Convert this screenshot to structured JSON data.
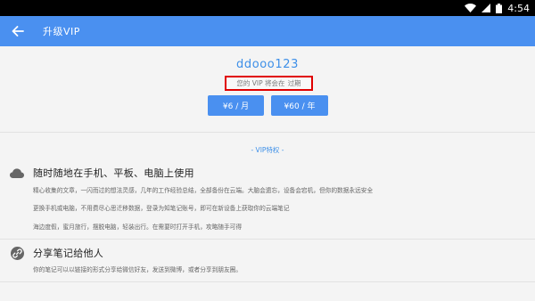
{
  "statusbar": {
    "time": "4:54"
  },
  "appbar": {
    "title": "升级VIP"
  },
  "account": {
    "username": "ddooo123",
    "expire_prefix": "您的 VIP 将会在",
    "expire_suffix": "过期"
  },
  "plans": {
    "month_label": "¥6 / 月",
    "year_label": "¥60 / 年"
  },
  "vip_section": {
    "title": "- VIP特权 -"
  },
  "features": [
    {
      "icon": "cloud-icon",
      "title": "随时随地在手机、平板、电脑上使用",
      "lines": [
        "精心收集的文章，一闪而过的想法灵感，几年的工作经验总结，全部备份在云端。大脑会遗忘，设备会宕机，但你的数据永远安全",
        "更换手机或电脑，不用费尽心思迁移数据，登录为知笔记账号，即可在新设备上获取你的云端笔记",
        "海边度假，蜜月旅行，摆脱电脑，轻装出行。在需要时打开手机，攻略随手可得"
      ]
    },
    {
      "icon": "link-icon",
      "title": "分享笔记给他人",
      "lines": [
        "你的笔记可以以链接的形式分享给微信好友，发送到微博，或者分享到朋友圈。"
      ]
    }
  ],
  "colors": {
    "accent": "#4a90f0",
    "highlight_border": "#e00000"
  }
}
